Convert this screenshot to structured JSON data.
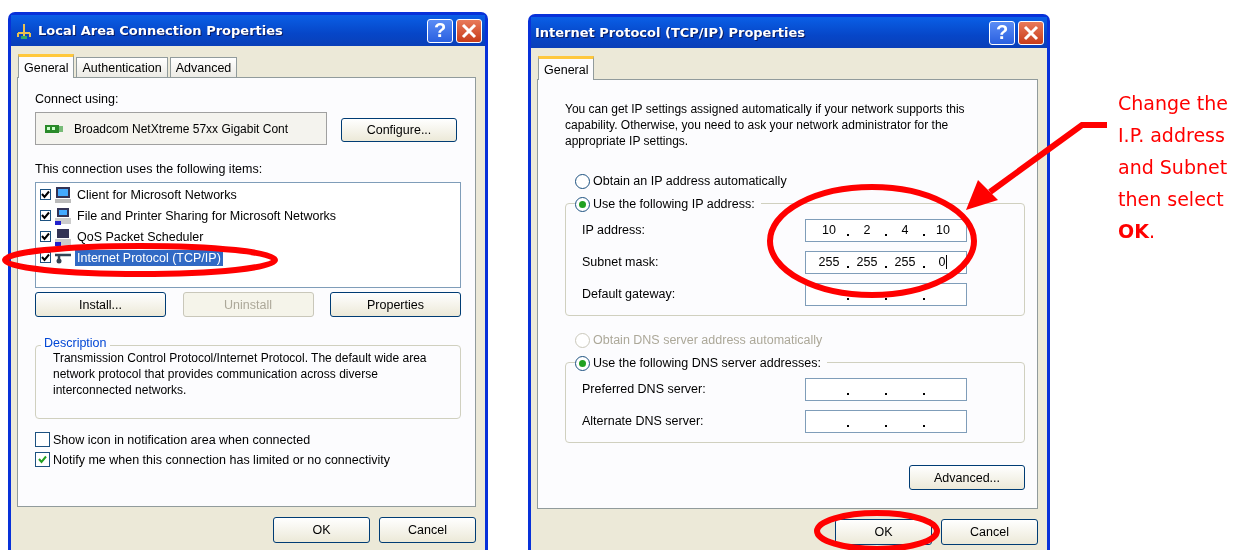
{
  "lan_dialog": {
    "title": "Local Area Connection Properties",
    "help_button": "?",
    "tabs": [
      {
        "label": "General",
        "selected": true
      },
      {
        "label": "Authentication",
        "selected": false
      },
      {
        "label": "Advanced",
        "selected": false
      }
    ],
    "connect_using_label": "Connect using:",
    "adapter": "Broadcom NetXtreme 57xx Gigabit Cont",
    "configure_button": "Configure...",
    "items_label": "This connection uses the following items:",
    "items": [
      {
        "label": "Client for Microsoft Networks",
        "checked": true,
        "selected": false
      },
      {
        "label": "File and Printer Sharing for Microsoft Networks",
        "checked": true,
        "selected": false
      },
      {
        "label": "QoS Packet Scheduler",
        "checked": true,
        "selected": false
      },
      {
        "label": "Internet Protocol (TCP/IP)",
        "checked": true,
        "selected": true
      }
    ],
    "item_buttons": [
      {
        "label": "Install...",
        "disabled": false
      },
      {
        "label": "Uninstall",
        "disabled": true
      },
      {
        "label": "Properties",
        "disabled": false
      }
    ],
    "description": {
      "title": "Description",
      "text": "Transmission Control Protocol/Internet Protocol. The default wide area network protocol that provides communication across diverse interconnected networks."
    },
    "options": [
      {
        "label": "Show icon in notification area when connected",
        "checked": false
      },
      {
        "label": "Notify me when this connection has limited or no connectivity",
        "checked": true
      }
    ],
    "footer_buttons": [
      "OK",
      "Cancel"
    ]
  },
  "tcpip_dialog": {
    "title": "Internet Protocol (TCP/IP) Properties",
    "help_button": "?",
    "tabs": [
      {
        "label": "General",
        "selected": true
      }
    ],
    "intro": "You can get IP settings assigned automatically if your network supports this capability. Otherwise, you need to ask your network administrator for the appropriate IP settings.",
    "ip_modes": [
      {
        "label": "Obtain an IP address automatically",
        "selected": false,
        "disabled": false
      },
      {
        "label": "Use the following IP address:",
        "selected": true,
        "disabled": false
      }
    ],
    "ip_fields": [
      {
        "label": "IP address:",
        "octets": [
          "10",
          "2",
          "4",
          "10"
        ],
        "focused": false
      },
      {
        "label": "Subnet mask:",
        "octets": [
          "255",
          "255",
          "255",
          "0"
        ],
        "focused": true
      },
      {
        "label": "Default gateway:",
        "focused": false
      }
    ],
    "dns_modes": [
      {
        "label": "Obtain DNS server address automatically",
        "selected": false,
        "disabled": true
      },
      {
        "label": "Use the following DNS server addresses:",
        "selected": true,
        "disabled": false
      }
    ],
    "dns_fields": [
      {
        "label": "Preferred DNS server:",
        "focused": false
      },
      {
        "label": "Alternate DNS server:",
        "focused": false
      }
    ],
    "advanced_button": "Advanced...",
    "footer_buttons": [
      "OK",
      "Cancel"
    ]
  },
  "annotation": {
    "lines": [
      "Change the",
      "I.P. address",
      "and Subnet",
      "then select",
      "**OK**."
    ]
  }
}
